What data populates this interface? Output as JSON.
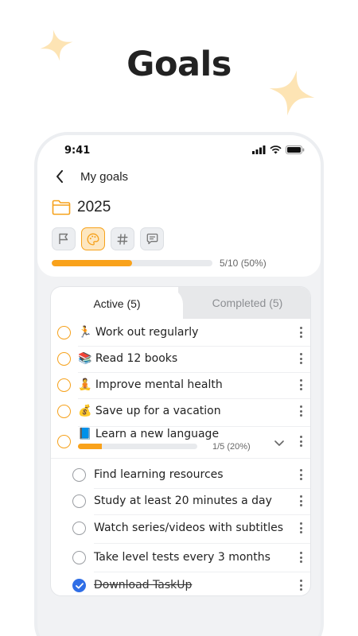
{
  "hero": {
    "title": "Goals"
  },
  "colors": {
    "accent": "#f9a21b",
    "sparkle": "#fde4b4",
    "check": "#2f6ee6"
  },
  "statusbar": {
    "time": "9:41",
    "icons": [
      "signal-icon",
      "wifi-icon",
      "battery-icon"
    ]
  },
  "header": {
    "title": "My goals",
    "back_icon": "chevron-left-icon"
  },
  "folder": {
    "icon": "folder-icon",
    "name": "2025"
  },
  "toolbar": {
    "icons": [
      "flag-icon",
      "palette-icon",
      "hashtag-icon",
      "comment-icon"
    ],
    "active": "palette-icon"
  },
  "progress": {
    "label": "5/10 (50%)",
    "fraction": 0.5
  },
  "tabs": {
    "active": "Active (5)",
    "completed": "Completed (5)"
  },
  "goals": [
    {
      "emoji": "🏃",
      "text": "Work out regularly"
    },
    {
      "emoji": "📚",
      "text": "Read 12 books"
    },
    {
      "emoji": "🧘",
      "text": "Improve mental health"
    },
    {
      "emoji": "💰",
      "text": "Save up for a vacation"
    },
    {
      "emoji": "📘",
      "text": "Learn a new language",
      "progress_label": "1/5 (20%)",
      "progress_fraction": 0.2
    }
  ],
  "subtasks": [
    {
      "text": "Find learning resources",
      "done": false
    },
    {
      "text": "Study at least 20 minutes a day",
      "done": false
    },
    {
      "text": "Watch series/videos with subtitles",
      "done": false
    },
    {
      "text": "Take level tests every 3 months",
      "done": false
    },
    {
      "text": "Download TaskUp",
      "done": true
    }
  ]
}
